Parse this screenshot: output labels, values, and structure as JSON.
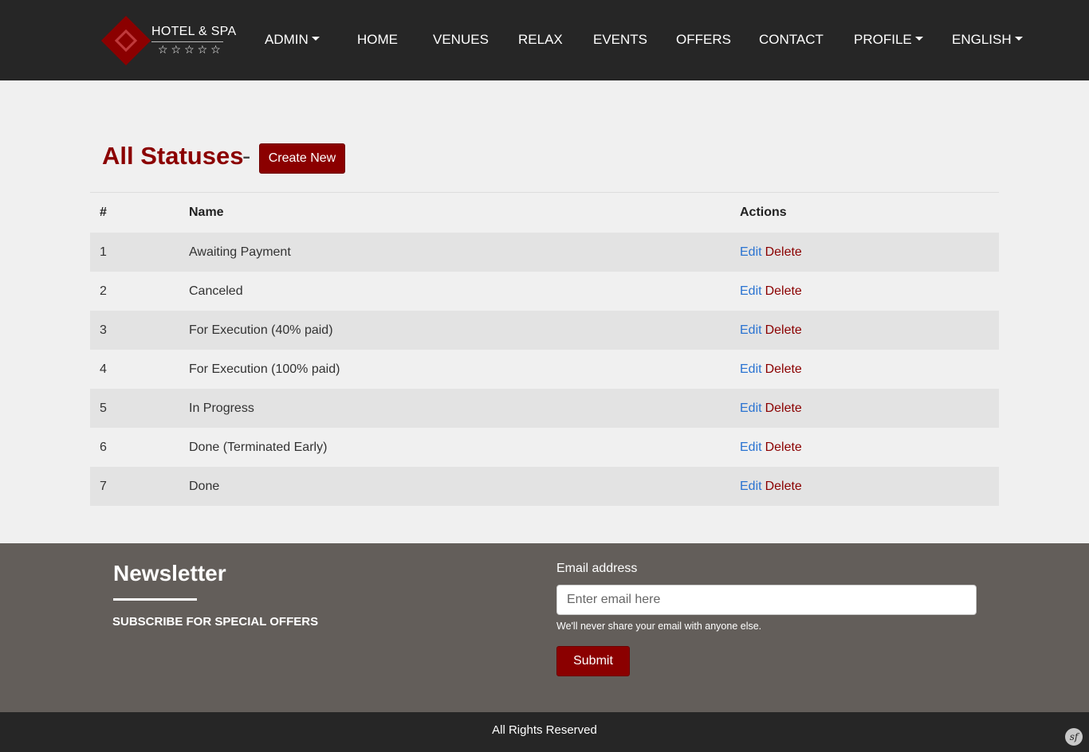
{
  "brand": {
    "name": "HOTEL & SPA",
    "stars": "☆☆☆☆☆",
    "color": "#8b0000"
  },
  "nav": {
    "admin": "ADMIN",
    "home": "HOME",
    "venues": "VENUES",
    "relax": "RELAX",
    "events": "EVENTS",
    "offers": "OFFERS",
    "contact": "CONTACT",
    "profile": "PROFILE",
    "language": "ENGLISH"
  },
  "page": {
    "title": "All Statuses",
    "separator": "-",
    "create_label": "Create New"
  },
  "table": {
    "headers": {
      "id": "#",
      "name": "Name",
      "actions": "Actions"
    },
    "edit_label": "Edit",
    "delete_label": "Delete",
    "rows": [
      {
        "id": "1",
        "name": "Awaiting Payment"
      },
      {
        "id": "2",
        "name": "Canceled"
      },
      {
        "id": "3",
        "name": "For Execution (40% paid)"
      },
      {
        "id": "4",
        "name": "For Execution (100% paid)"
      },
      {
        "id": "5",
        "name": "In Progress"
      },
      {
        "id": "6",
        "name": "Done (Terminated Early)"
      },
      {
        "id": "7",
        "name": "Done"
      }
    ]
  },
  "newsletter": {
    "title": "Newsletter",
    "subtitle": "SUBSCRIBE FOR SPECIAL OFFERS",
    "email_label": "Email address",
    "email_placeholder": "Enter email here",
    "email_value": "",
    "help_text": "We'll never share your email with anyone else.",
    "submit_label": "Submit"
  },
  "footer": {
    "copyright": "All Rights Reserved",
    "sf_icon": "sf"
  }
}
